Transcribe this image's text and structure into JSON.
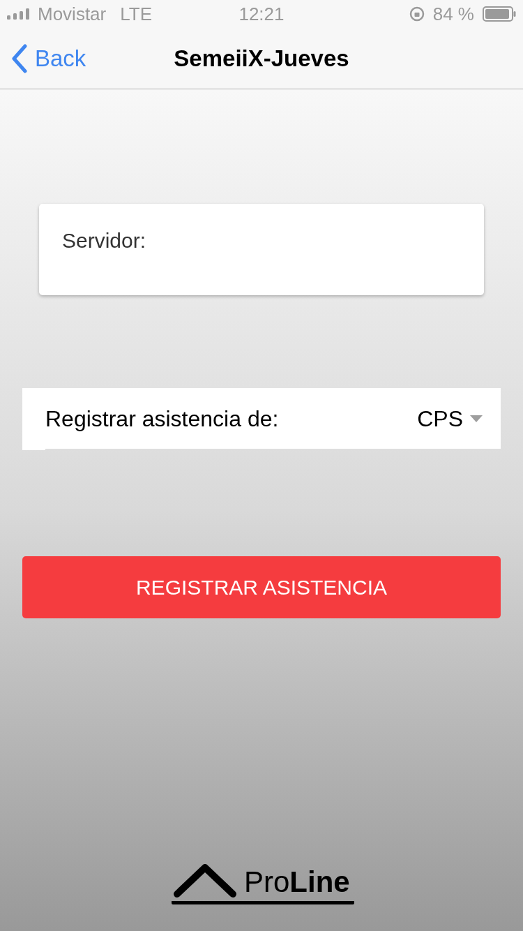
{
  "status_bar": {
    "carrier": "Movistar",
    "network": "LTE",
    "time": "12:21",
    "battery": "84 %"
  },
  "nav_bar": {
    "back": "Back",
    "title": "SemeiiX-Jueves"
  },
  "server_card": {
    "label": "Servidor:"
  },
  "attendance_select": {
    "label": "Registrar asistencia de:",
    "value": "CPS"
  },
  "submit_button": {
    "label": "REGISTRAR ASISTENCIA"
  },
  "logo": {
    "text": "Pro**Line**"
  }
}
